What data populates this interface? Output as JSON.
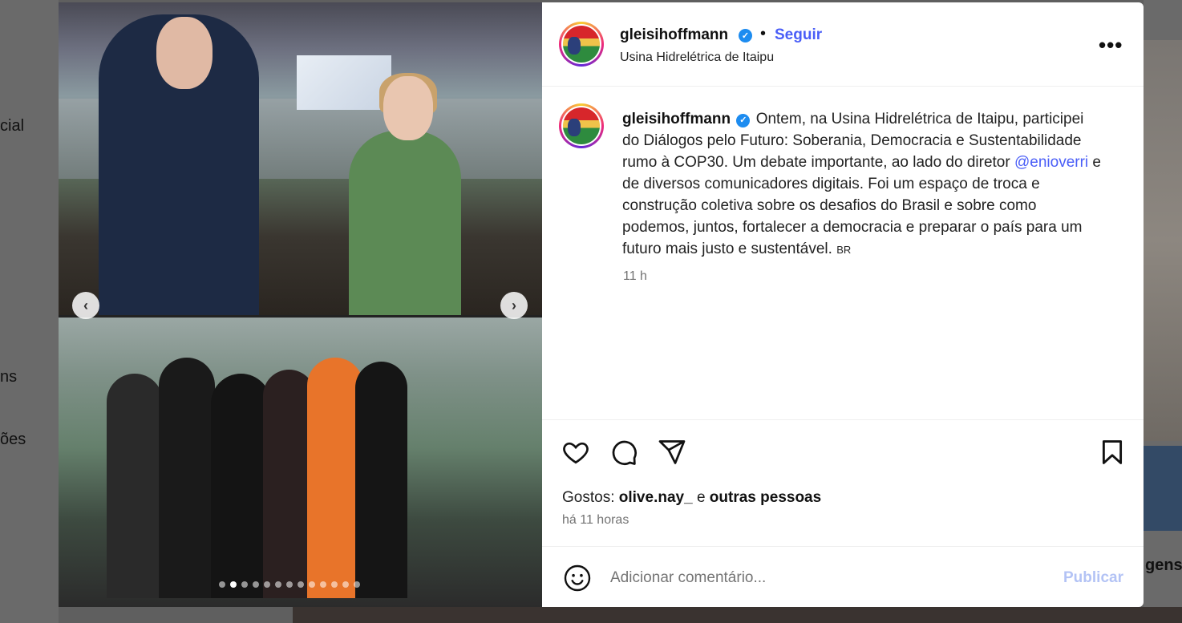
{
  "background": {
    "left_labels": [
      "cial",
      "ns",
      "ões"
    ],
    "right_label": "gens"
  },
  "media": {
    "prev_symbol": "‹",
    "next_symbol": "›",
    "slide_count": 13,
    "active_slide": 2
  },
  "post": {
    "username": "gleisihoffmann",
    "verified_symbol": "✓",
    "separator": "•",
    "follow_label": "Seguir",
    "location": "Usina Hidrelétrica de Itaipu",
    "more_label": "•••",
    "caption_part1": "Ontem, na Usina Hidrelétrica de Itaipu, participei do Diálogos pelo Futuro: Soberania, Democracia e Sustentabilidade rumo à COP30. Um debate importante, ao lado do diretor ",
    "caption_mention": "@enioverri",
    "caption_part2": " e de diversos comunicadores digitais. Foi um espaço de troca e construção coletiva sobre os desafios do Brasil e sobre como podemos, juntos, fortalecer a democracia e preparar o país para um futuro mais justo e sustentável. ",
    "caption_flag": "BR",
    "time": "11 h",
    "likes_prefix": "Gostos:",
    "likes_user": "olive.nay_",
    "likes_and": "e",
    "likes_others": "outras pessoas",
    "posted_ago": "há 11 horas",
    "comment_placeholder": "Adicionar comentário...",
    "publish_label": "Publicar"
  },
  "colors": {
    "link_blue": "#4a5ef7",
    "verified_blue": "#1d8cf0",
    "publish_disabled": "#b3c3f5"
  },
  "icons": [
    "heart-icon",
    "comment-icon",
    "share-icon",
    "bookmark-icon",
    "emoji-icon",
    "more-options-icon",
    "chevron-left-icon",
    "chevron-right-icon",
    "verified-badge-icon"
  ]
}
